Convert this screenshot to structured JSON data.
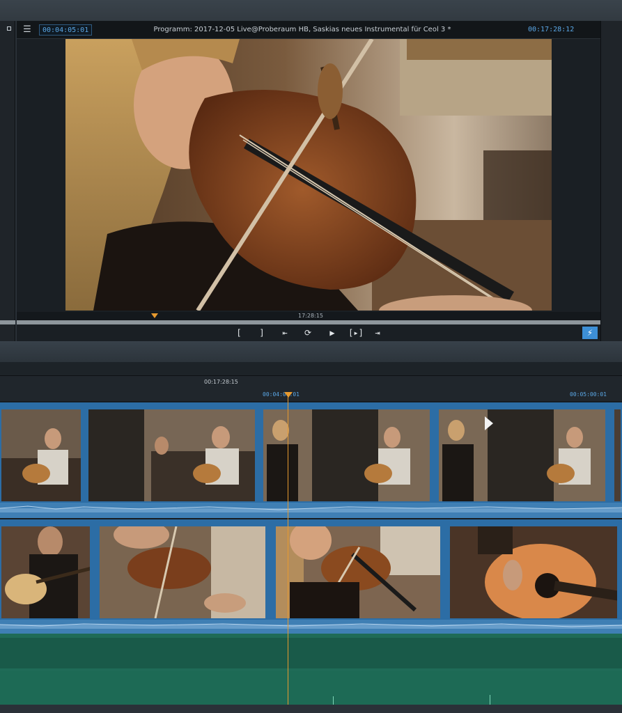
{
  "monitor": {
    "timecode_left": "00:04:05:01",
    "title": "Programm: 2017-12-05 Live@Proberaum HB, Saskias neues Instrumental für Ceol 3 *",
    "timecode_right": "00:17:28:12",
    "ruler_label": "17:28:15",
    "controls": {
      "mark_in": "[",
      "mark_out": "]",
      "go_to_in": "⇤",
      "loop": "⟳",
      "play": "▶",
      "play_in_to_out": "[▸]",
      "go_to_out": "⇥",
      "bolt": "⚡"
    }
  },
  "timeline": {
    "ruler_label": "00:17:28:15",
    "tc_in": "00:04:00:01",
    "tc_out": "00:05:00:01"
  },
  "colors": {
    "accent": "#3d8fd6",
    "playhead": "#e79a2f",
    "track_video": "#2c6da5",
    "track_green": "#1f6b57"
  }
}
